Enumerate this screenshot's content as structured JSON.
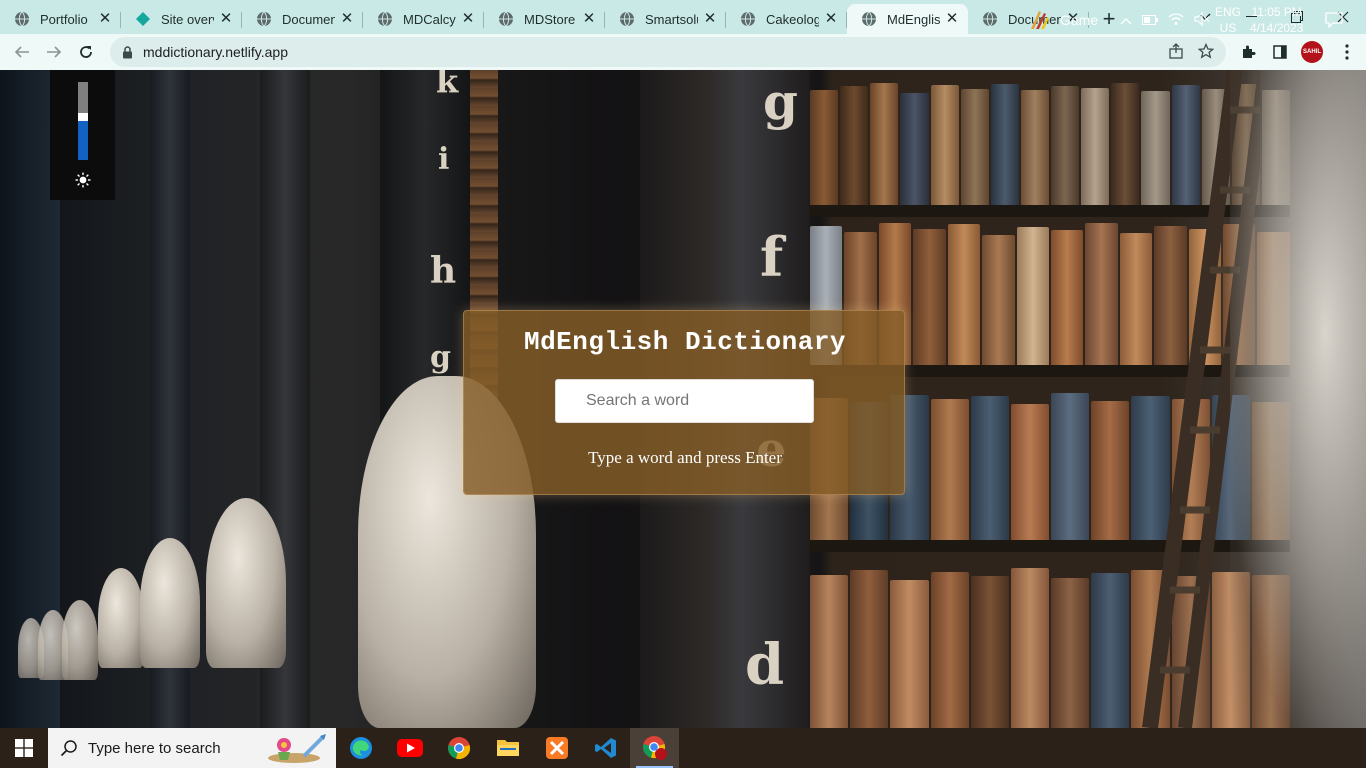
{
  "browser": {
    "tabs": [
      {
        "title": "Portfolio",
        "icon": "globe-icon",
        "active": false
      },
      {
        "title": "Site overvi",
        "icon": "netlify-icon",
        "active": false
      },
      {
        "title": "Document",
        "icon": "globe-icon",
        "active": false
      },
      {
        "title": "MDCalcy",
        "icon": "globe-icon",
        "active": false
      },
      {
        "title": "MDStore",
        "icon": "globe-icon",
        "active": false
      },
      {
        "title": "Smartsolut",
        "icon": "globe-icon",
        "active": false
      },
      {
        "title": "Cakeology",
        "icon": "globe-icon",
        "active": false
      },
      {
        "title": "MdEnglish",
        "icon": "globe-icon",
        "active": true
      },
      {
        "title": "Document",
        "icon": "globe-icon",
        "active": false
      }
    ],
    "url": "mddictionary.netlify.app",
    "profile_badge": "SAHIL",
    "colors": {
      "tabstrip": "#c9e9e6",
      "toolbar": "#eef9f8",
      "omnibox": "#dcedeb"
    }
  },
  "page": {
    "background_letters": [
      "k",
      "i",
      "h",
      "g",
      "g",
      "f",
      "e",
      "d"
    ],
    "brightness": {
      "level": 0.5,
      "icon": "sun-icon"
    },
    "card": {
      "title": "MdEnglish Dictionary",
      "search_placeholder": "Search a word",
      "hint": "Type a word and press Enter"
    }
  },
  "taskbar": {
    "search_placeholder": "Type here to search",
    "apps": [
      "edge-icon",
      "youtube-icon",
      "chrome-icon",
      "file-explorer-icon",
      "xampp-icon",
      "vscode-icon",
      "chrome-profile-icon"
    ],
    "game_label": "Game",
    "lang_top": "ENG",
    "lang_bottom": "US",
    "time": "11:05 PM",
    "date": "4/14/2023"
  }
}
